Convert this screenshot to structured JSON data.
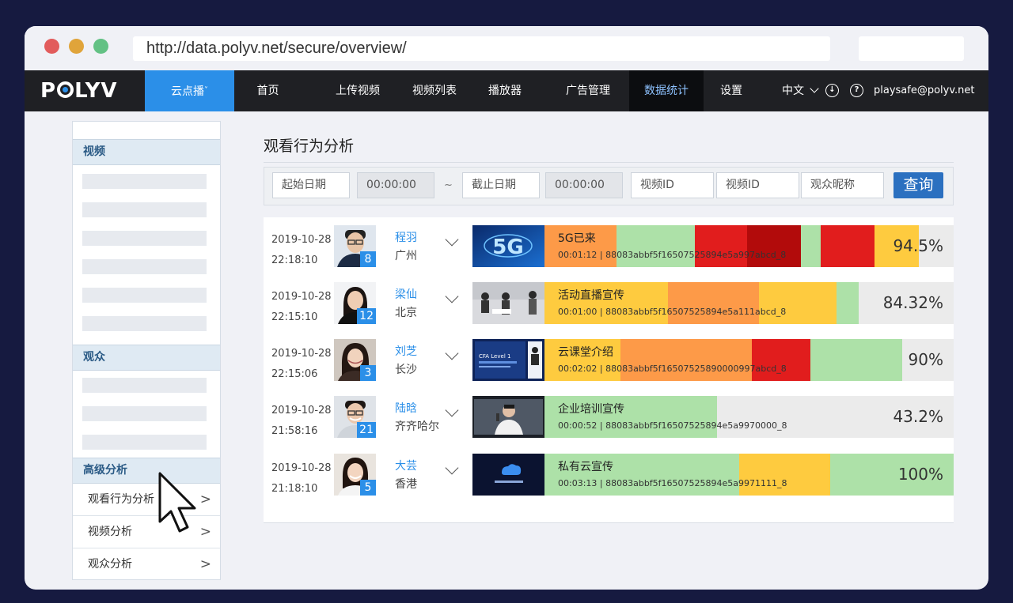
{
  "browser": {
    "url": "http://data.polyv.net/secure/overview/"
  },
  "nav": {
    "logo": "POLYV",
    "items": [
      {
        "label": "云点播",
        "caret": "˅"
      },
      {
        "label": "首页"
      },
      {
        "label": "上传视频"
      },
      {
        "label": "视频列表"
      },
      {
        "label": "播放器"
      },
      {
        "label": "广告管理"
      },
      {
        "label": "数据统计"
      },
      {
        "label": "设置"
      }
    ],
    "language": "中文",
    "email": "playsafe@polyv.net",
    "download_icon": "download-icon",
    "help_icon": "help-icon"
  },
  "sidebar": {
    "sections": [
      "视频",
      "观众",
      "高级分析"
    ],
    "items": [
      "观看行为分析",
      "视频分析",
      "观众分析"
    ],
    "arrow": ">"
  },
  "main": {
    "title": "观看行为分析",
    "filters": {
      "start_date": "起始日期",
      "start_time": "00:00:00",
      "tilde": "~",
      "end_date": "截止日期",
      "end_time": "00:00:00",
      "video_id_1": "视频ID",
      "video_id_2": "视频ID",
      "viewer_nick": "观众昵称",
      "query": "查询"
    },
    "rows": [
      {
        "date": "2019-10-28",
        "time": "22:18:10",
        "name": "程羽",
        "city": "广州",
        "badge": "8",
        "video_title": "5G已来",
        "video_meta": "00:01:12 | 88083abbf5f16507525894e5a997abcd_8",
        "percent": "94.5%",
        "thumb_text": "5G"
      },
      {
        "date": "2019-10-28",
        "time": "22:15:10",
        "name": "梁仙",
        "city": "北京",
        "badge": "12",
        "video_title": "活动直播宣传",
        "video_meta": "00:01:00 | 88083abbf5f16507525894e5a111abcd_8",
        "percent": "84.32%"
      },
      {
        "date": "2019-10-28",
        "time": "22:15:06",
        "name": "刘芝",
        "city": "长沙",
        "badge": "3",
        "video_title": "云课堂介绍",
        "video_meta": "00:02:02 | 88083abbf5f16507525890000997abcd_8",
        "percent": "90%",
        "thumb_text": "CFA Level 1"
      },
      {
        "date": "2019-10-28",
        "time": "21:58:16",
        "name": "陆晗",
        "city": "齐齐哈尔",
        "badge": "21",
        "video_title": "企业培训宣传",
        "video_meta": "00:00:52 | 88083abbf5f16507525894e5a9970000_8",
        "percent": "43.2%"
      },
      {
        "date": "2019-10-28",
        "time": "21:18:10",
        "name": "大芸",
        "city": "香港",
        "badge": "5",
        "video_title": "私有云宣传",
        "video_meta": "00:03:13 | 88083abbf5f16507525894e5a9971111_8",
        "percent": "100%"
      }
    ]
  },
  "colors": {
    "accent": "#2b8fe8",
    "navbar": "#1f2024",
    "heat_low": "#ade1a8",
    "heat_mid": "#fecb3f",
    "heat_orange": "#fd9a48",
    "heat_high": "#e11d1d",
    "heat_max": "#b20b0b"
  }
}
